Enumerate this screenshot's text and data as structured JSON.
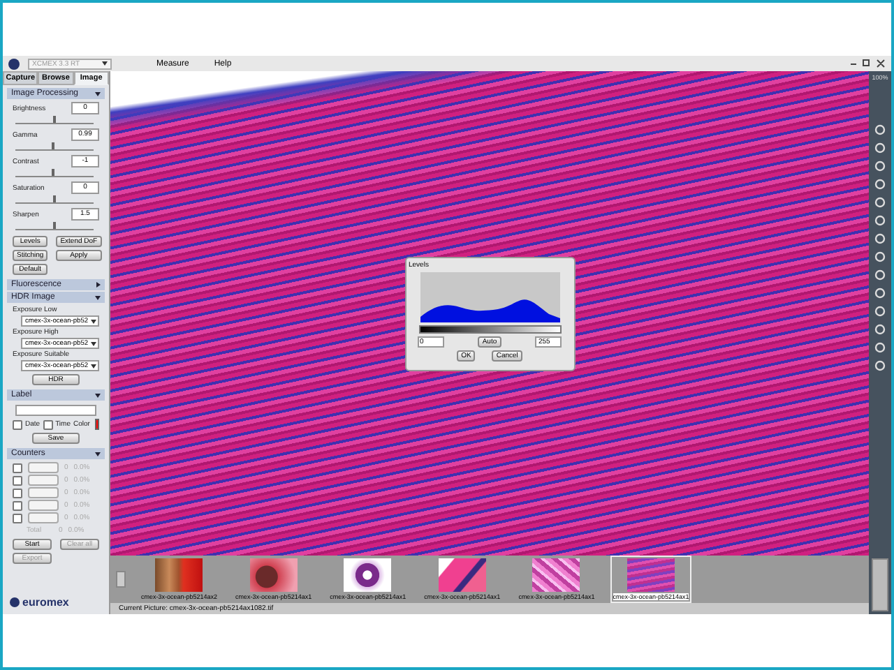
{
  "app": {
    "version_dropdown": "XCMEX 3.3 RT",
    "menu": [
      "Measure",
      "Help"
    ]
  },
  "tabs": [
    {
      "label": "Capture",
      "selected": false
    },
    {
      "label": "Browse",
      "selected": false
    },
    {
      "label": "Image",
      "selected": true
    }
  ],
  "image_processing": {
    "title": "Image Processing",
    "expanded": true,
    "sliders": [
      {
        "label": "Brightness",
        "value": "0",
        "level": 0.5
      },
      {
        "label": "Gamma",
        "value": "0.99",
        "level": 0.48
      },
      {
        "label": "Contrast",
        "value": "-1",
        "level": 0.48
      },
      {
        "label": "Saturation",
        "value": "0",
        "level": 0.5
      },
      {
        "label": "Sharpen",
        "value": "1.5",
        "level": 0.5
      }
    ],
    "buttons": [
      "Levels",
      "Extend DoF",
      "Stitching",
      "Apply",
      "Default"
    ]
  },
  "fluorescence": {
    "title": "Fluorescence",
    "expanded": false
  },
  "hdr": {
    "title": "HDR Image",
    "expanded": true,
    "exposures": [
      {
        "label": "Exposure Low",
        "value": "cmex-3x-ocean-pb52"
      },
      {
        "label": "Exposure High",
        "value": "cmex-3x-ocean-pb52"
      },
      {
        "label": "Exposure Suitable",
        "value": "cmex-3x-ocean-pb52"
      }
    ],
    "button": "HDR"
  },
  "label": {
    "title": "Label",
    "expanded": true,
    "checkboxes": [
      {
        "label": "Date",
        "checked": false
      },
      {
        "label": "Time",
        "checked": false
      }
    ],
    "color_label": "Color",
    "color": "#ff0000",
    "button": "Save"
  },
  "counters": {
    "title": "Counters",
    "expanded": true,
    "rows": [
      {
        "checked": false,
        "count": "0",
        "percent": "0.0%"
      },
      {
        "checked": false,
        "count": "0",
        "percent": "0.0%"
      },
      {
        "checked": false,
        "count": "0",
        "percent": "0.0%"
      },
      {
        "checked": false,
        "count": "0",
        "percent": "0.0%"
      },
      {
        "checked": false,
        "count": "0",
        "percent": "0.0%"
      }
    ],
    "total": {
      "label": "Total",
      "count": "0",
      "percent": "0.0%"
    },
    "buttons": [
      "Start",
      "Clear all",
      "Export"
    ]
  },
  "brand": "euromex",
  "viewer": {
    "zoom": "100%"
  },
  "levels_dialog": {
    "title": "Levels",
    "low": "0",
    "high": "255",
    "buttons": [
      "Auto",
      "OK",
      "Cancel"
    ]
  },
  "thumbnails": [
    {
      "caption": "cmex-3x-ocean-pb5214ax2",
      "selected": false
    },
    {
      "caption": "cmex-3x-ocean-pb5214ax1",
      "selected": false
    },
    {
      "caption": "cmex-3x-ocean-pb5214ax1",
      "selected": false
    },
    {
      "caption": "cmex-3x-ocean-pb5214ax1",
      "selected": false
    },
    {
      "caption": "cmex-3x-ocean-pb5214ax1",
      "selected": false
    },
    {
      "caption": "cmex-3x-ocean-pb5214ax1",
      "selected": true
    }
  ],
  "status_bar": "Current Picture: cmex-3x-ocean-pb5214ax1082.tif"
}
